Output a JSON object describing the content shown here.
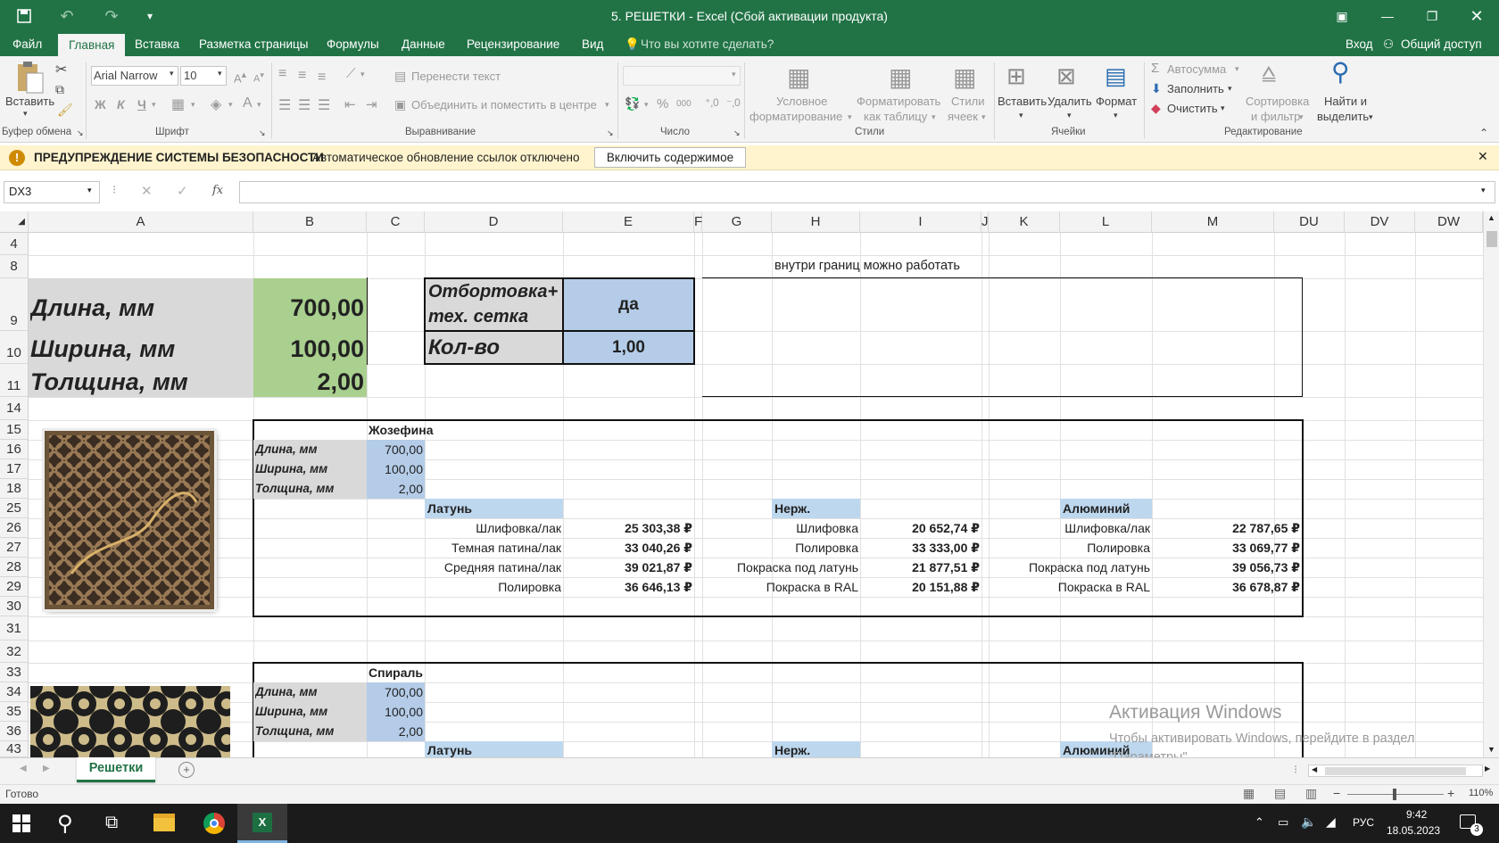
{
  "title": "5. РЕШЕТКИ - Excel (Сбой активации продукта)",
  "menu": {
    "file": "Файл",
    "home": "Главная",
    "insert": "Вставка",
    "layout": "Разметка страницы",
    "formulas": "Формулы",
    "data": "Данные",
    "review": "Рецензирование",
    "view": "Вид",
    "tell_me": "Что вы хотите сделать?",
    "signin": "Вход",
    "share": "Общий доступ"
  },
  "ribbon": {
    "paste": "Вставить",
    "font_name": "Arial Narrow",
    "font_size": "10",
    "bold": "Ж",
    "italic": "К",
    "underline": "Ч",
    "wrap_text": "Перенести текст",
    "merge_center": "Объединить и поместить в центре",
    "percent": "%",
    "thousands": "000",
    "cond_format_1": "Условное",
    "cond_format_2": "форматирование",
    "format_table_1": "Форматировать",
    "format_table_2": "как таблицу",
    "cell_styles_1": "Стили",
    "cell_styles_2": "ячеек",
    "insert_cells": "Вставить",
    "delete_cells": "Удалить",
    "format_cells": "Формат",
    "autosum": "Автосумма",
    "fill": "Заполнить",
    "clear": "Очистить",
    "sort_filter_1": "Сортировка",
    "sort_filter_2": "и фильтр",
    "find_select_1": "Найти и",
    "find_select_2": "выделить",
    "groups": {
      "clipboard": "Буфер обмена",
      "font": "Шрифт",
      "alignment": "Выравнивание",
      "number": "Число",
      "styles": "Стили",
      "cells": "Ячейки",
      "editing": "Редактирование"
    }
  },
  "security": {
    "title": "ПРЕДУПРЕЖДЕНИЕ СИСТЕМЫ БЕЗОПАСНОСТИ",
    "message": "Автоматическое обновление ссылок отключено",
    "button": "Включить содержимое"
  },
  "formula": {
    "name_box": "DX3",
    "fx": "fx",
    "value": ""
  },
  "columns": [
    "A",
    "B",
    "C",
    "D",
    "E",
    "F",
    "G",
    "H",
    "I",
    "J",
    "K",
    "L",
    "M",
    "DU",
    "DV",
    "DW"
  ],
  "rows": [
    "4",
    "8",
    "9",
    "10",
    "11",
    "14",
    "15",
    "16",
    "17",
    "18",
    "25",
    "26",
    "27",
    "28",
    "29",
    "30",
    "31",
    "32",
    "33",
    "34",
    "35",
    "36",
    "43"
  ],
  "sheet": {
    "note": "внутри границ можно работать",
    "length_label": "Длина, мм",
    "length_value": "700,00",
    "width_label": "Ширина, мм",
    "width_value": "100,00",
    "thick_label": "Толщина, мм",
    "thick_value": "2,00",
    "flange_label_1": "Отбортовка+",
    "flange_label_2": "тех. сетка",
    "flange_value": "да",
    "qty_label": "Кол-во",
    "qty_value": "1,00",
    "blocks": [
      {
        "name": "Жозефина",
        "length_label": "Длина, мм",
        "length_value": "700,00",
        "width_label": "Ширина, мм",
        "width_value": "100,00",
        "thick_label": "Толщина, мм",
        "thick_value": "2,00",
        "brass": {
          "title": "Латунь",
          "rows": [
            {
              "label": "Шлифовка/лак",
              "price": "25 303,38 ₽"
            },
            {
              "label": "Темная патина/лак",
              "price": "33 040,26 ₽"
            },
            {
              "label": "Средняя патина/лак",
              "price": "39 021,87 ₽"
            },
            {
              "label": "Полировка",
              "price": "36 646,13 ₽"
            }
          ]
        },
        "steel": {
          "title": "Нерж.",
          "rows": [
            {
              "label": "Шлифовка",
              "price": "20 652,74 ₽"
            },
            {
              "label": "Полировка",
              "price": "33 333,00 ₽"
            },
            {
              "label": "Покраска под латунь",
              "price": "21 877,51 ₽"
            },
            {
              "label": "Покраска в RAL",
              "price": "20 151,88 ₽"
            }
          ]
        },
        "alu": {
          "title": "Алюминий",
          "rows": [
            {
              "label": "Шлифовка/лак",
              "price": "22 787,65 ₽"
            },
            {
              "label": "Полировка",
              "price": "33 069,77 ₽"
            },
            {
              "label": "Покраска под латунь",
              "price": "39 056,73 ₽"
            },
            {
              "label": "Покраска в RAL",
              "price": "36 678,87 ₽"
            }
          ]
        }
      },
      {
        "name": "Спираль",
        "length_label": "Длина, мм",
        "length_value": "700,00",
        "width_label": "Ширина, мм",
        "width_value": "100,00",
        "thick_label": "Толщина, мм",
        "thick_value": "2,00",
        "brass_title": "Латунь",
        "steel_title": "Нерж.",
        "alu_title": "Алюминий"
      }
    ]
  },
  "watermark": {
    "title": "Активация Windows",
    "sub": "Чтобы активировать Windows, перейдите в раздел \"Параметры\"."
  },
  "sheet_tab": "Решетки",
  "status": {
    "ready": "Готово",
    "zoom": "110%"
  },
  "taskbar": {
    "lang": "РУС",
    "time": "9:42",
    "date": "18.05.2023",
    "notif": "3"
  },
  "colors": {
    "excel_green": "#217346",
    "gray_cell": "#d9d9d9",
    "green_cell": "#a9d08e",
    "blue_cell": "#b4cce8",
    "blue_light": "#bdd7ee",
    "warning_bg": "#fff4ce"
  }
}
